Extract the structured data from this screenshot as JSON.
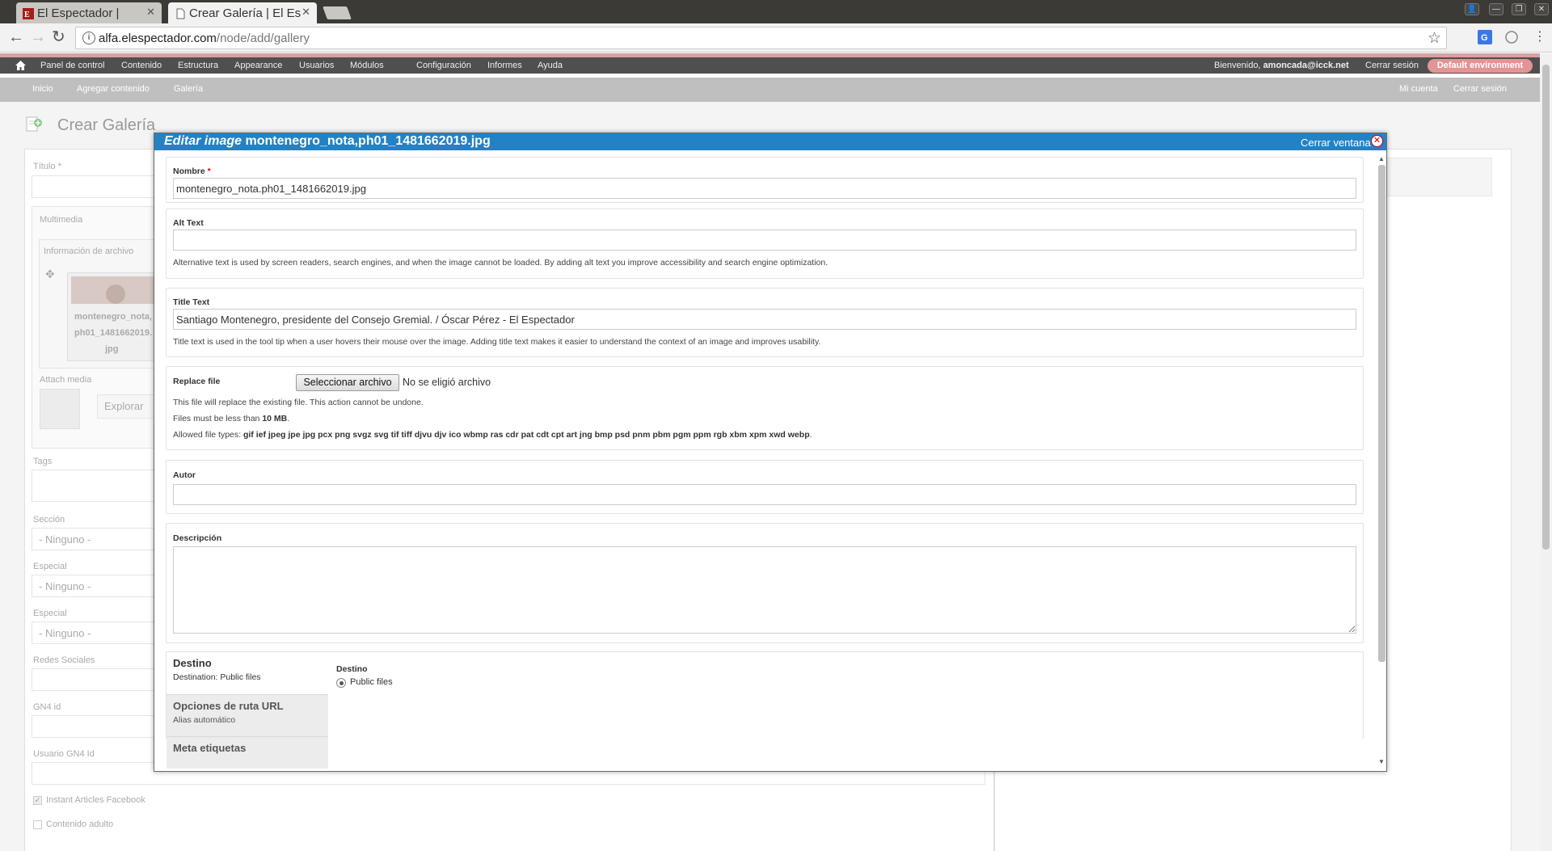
{
  "browser": {
    "tabs": [
      {
        "title": "El Espectador |",
        "active": false
      },
      {
        "title": "Crear Galería | El Es",
        "active": true
      }
    ],
    "url_host": "alfa.elespectador.com",
    "url_path": "/node/add/gallery"
  },
  "admin_menu": {
    "items": [
      "Panel de control",
      "Contenido",
      "Estructura",
      "Appearance",
      "Usuarios",
      "Módulos",
      "Configuración",
      "Informes",
      "Ayuda"
    ],
    "welcome_prefix": "Bienvenido,",
    "username": "amoncada@icck.net",
    "logout": "Cerrar sesión",
    "environment": "Default environment",
    "env_color": "#e39494"
  },
  "shortcuts": {
    "left": [
      "Inicio",
      "Agregar contenido",
      "Galería"
    ],
    "right": [
      "Mi cuenta",
      "Cerrar sesión"
    ]
  },
  "page": {
    "title": "Crear Galería",
    "bg_fields": {
      "titulo": "Título",
      "multimedia": "Multimedia",
      "file_info": "Información de archivo",
      "thumb_caption_1": "montenegro_nota,",
      "thumb_caption_2": "ph01_1481662019.",
      "thumb_caption_3": "jpg",
      "attach_media": "Attach media",
      "explore": "Explorar",
      "tags": "Tags",
      "seccion": "Sección",
      "especial_1": "Especial",
      "especial_2": "Especial",
      "ninguno": "- Ninguno -",
      "redes": "Redes Sociales",
      "gn4id": "GN4 id",
      "usuario_gn4": "Usuario GN4 Id",
      "instant_articles": "Instant Articles Facebook",
      "contenido_adulto": "Contenido adulto"
    }
  },
  "modal": {
    "title_italic": "Editar image",
    "title_file": "montenegro_nota,ph01_1481662019.jpg",
    "close_text": "Cerrar ventana",
    "header_color": "#2282c3",
    "nombre": {
      "label": "Nombre",
      "required": "*",
      "value": "montenegro_nota.ph01_1481662019.jpg"
    },
    "alt": {
      "label": "Alt Text",
      "value": "",
      "desc": "Alternative text is used by screen readers, search engines, and when the image cannot be loaded. By adding alt text you improve accessibility and search engine optimization."
    },
    "title_text": {
      "label": "Title Text",
      "value": "Santiago Montenegro, presidente del Consejo Gremial.  / Óscar Pérez - El Espectador",
      "desc": "Title text is used in the tool tip when a user hovers their mouse over the image. Adding title text makes it easier to understand the context of an image and improves usability."
    },
    "replace": {
      "label": "Replace file",
      "button": "Seleccionar archivo",
      "status": "No se eligió archivo",
      "desc1": "This file will replace the existing file. This action cannot be undone.",
      "desc2_prefix": "Files must be less than",
      "desc2_size": "10 MB",
      "desc2_suffix": ".",
      "desc3_prefix": "Allowed file types:",
      "desc3_types": "gif ief jpeg jpe jpg pcx png svgz svg tif tiff djvu djv ico wbmp ras cdr pat cdt cpt art jng bmp psd pnm pbm pgm ppm rgb xbm xpm xwd webp",
      "desc3_suffix": "."
    },
    "autor": {
      "label": "Autor",
      "value": ""
    },
    "descripcion": {
      "label": "Descripción",
      "value": ""
    },
    "vtabs": [
      {
        "title": "Destino",
        "summary": "Destination: Public files"
      },
      {
        "title": "Opciones de ruta URL",
        "summary": "Alias automático"
      },
      {
        "title": "Meta etiquetas",
        "summary": ""
      }
    ],
    "destino": {
      "label": "Destino",
      "option": "Public files"
    }
  }
}
